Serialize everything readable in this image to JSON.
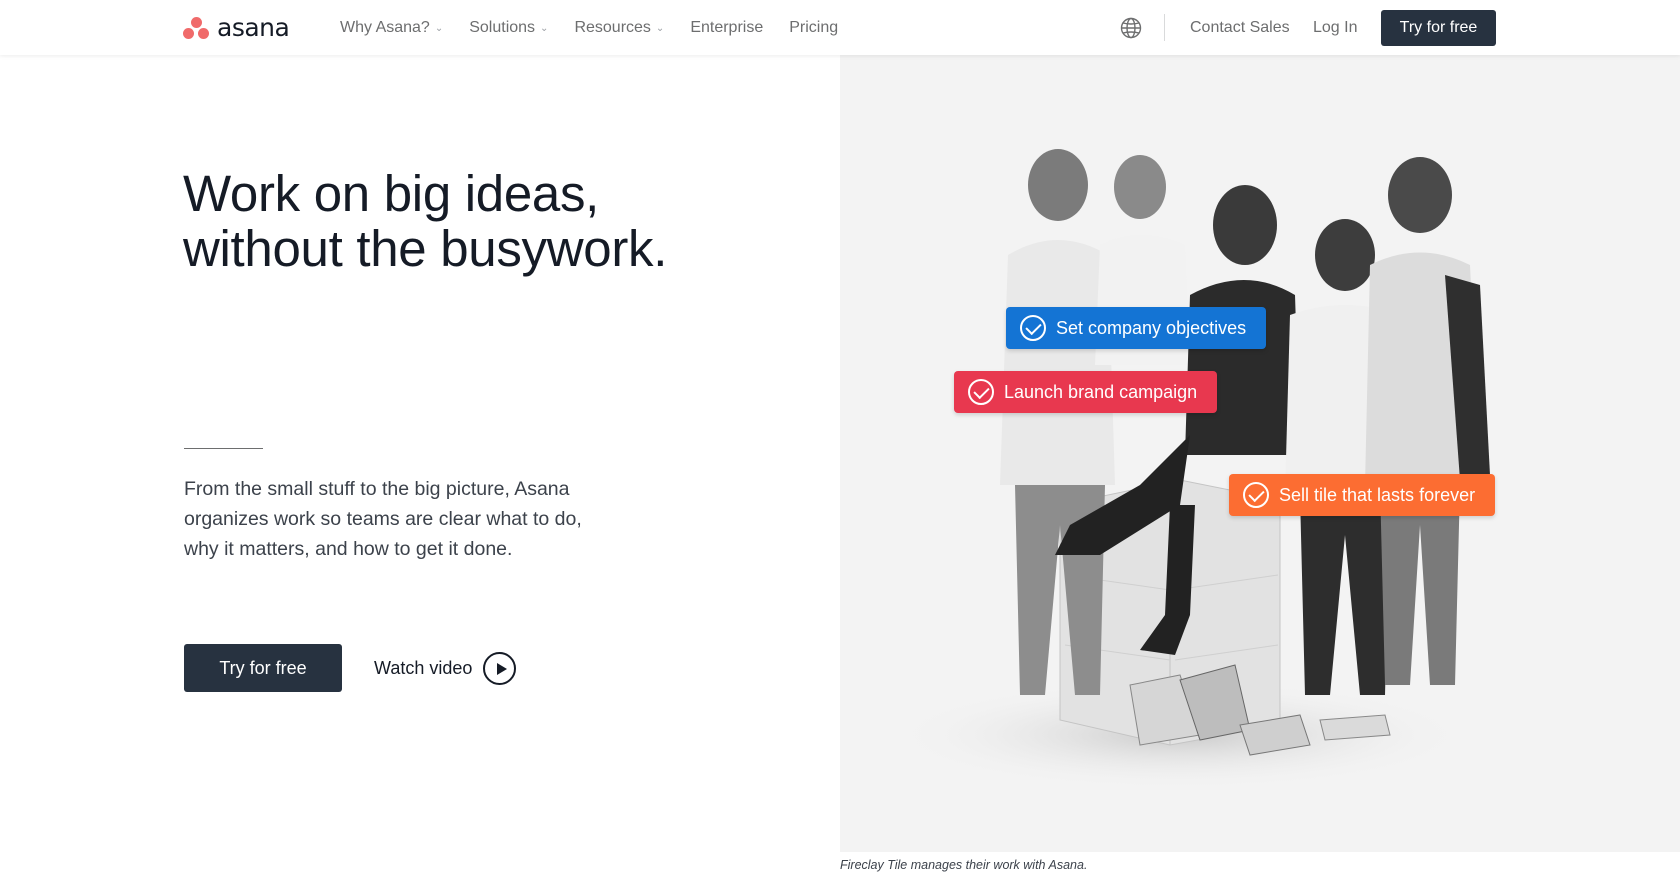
{
  "nav": {
    "logo_text": "asana",
    "links": [
      {
        "label": "Why Asana?",
        "dropdown": true
      },
      {
        "label": "Solutions",
        "dropdown": true
      },
      {
        "label": "Resources",
        "dropdown": true
      },
      {
        "label": "Enterprise",
        "dropdown": false
      },
      {
        "label": "Pricing",
        "dropdown": false
      }
    ],
    "globe_icon": "globe-icon",
    "contact_label": "Contact Sales",
    "login_label": "Log In",
    "cta_label": "Try for free"
  },
  "hero": {
    "headline_line1": "Work on big ideas,",
    "headline_line2": "without the busywork.",
    "subtext": "From the small stuff to the big picture, Asana organizes work so teams are clear what to do, why it matters, and how to get it done.",
    "cta_label": "Try for free",
    "watch_label": "Watch video"
  },
  "photo": {
    "tasks": [
      {
        "label": "Set company objectives",
        "color": "#1474d4"
      },
      {
        "label": "Launch brand campaign",
        "color": "#e8384f"
      },
      {
        "label": "Sell tile that lasts forever",
        "color": "#fc6d32"
      }
    ],
    "caption": "Fireclay Tile manages their work with Asana."
  },
  "colors": {
    "brand_coral": "#f06a6a",
    "button_dark": "#273240",
    "text_dark": "#151b26",
    "text_muted": "#6d6e6f"
  }
}
